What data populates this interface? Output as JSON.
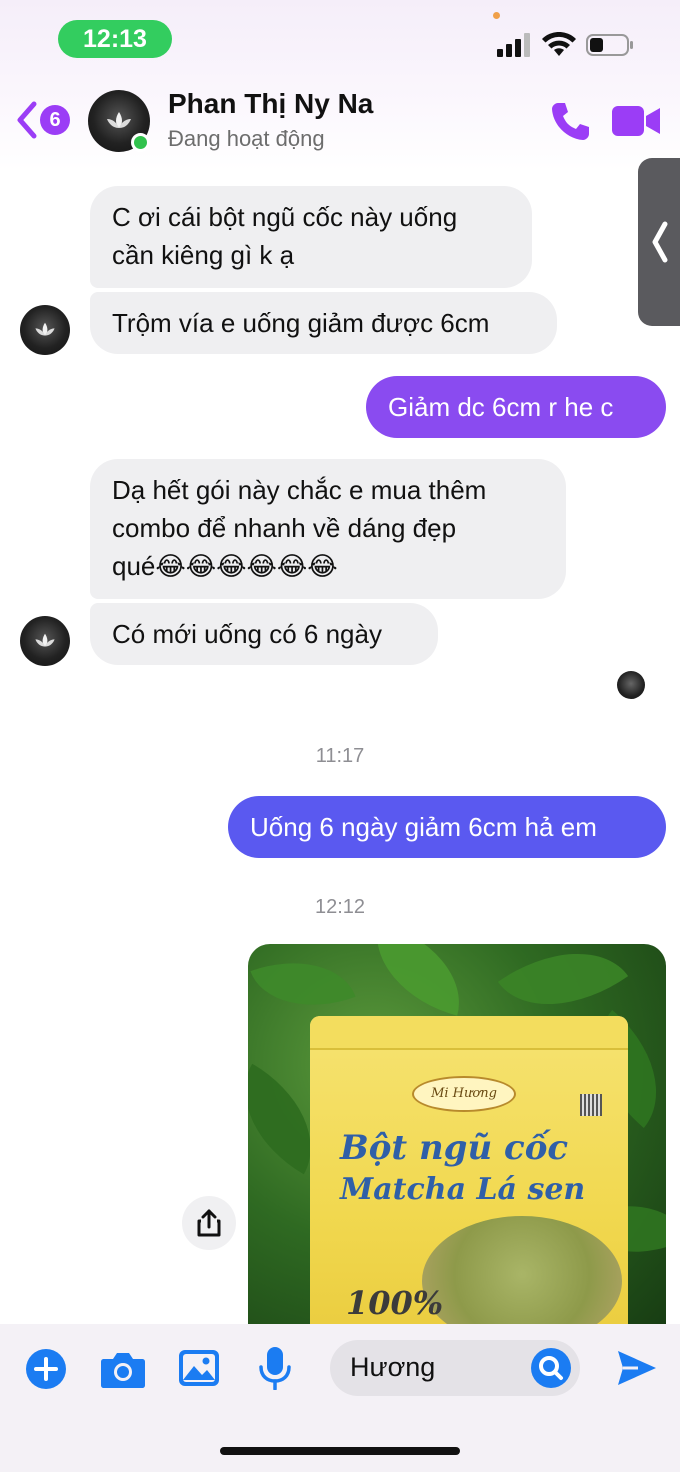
{
  "status_bar": {
    "time": "12:13"
  },
  "header": {
    "back_count": "6",
    "contact_name": "Phan Thị Ny Na",
    "contact_status": "Đang hoạt động"
  },
  "messages": [
    {
      "direction": "in",
      "text_lines": [
        "C ơi cái bột ngũ cốc này uống",
        "cần kiêng gì k ạ"
      ]
    },
    {
      "direction": "in",
      "text": "Trộm vía e uống giảm được 6cm"
    },
    {
      "direction": "out",
      "text": "Giảm dc 6cm r he c"
    },
    {
      "direction": "in",
      "text_lines": [
        "Dạ hết gói này chắc e mua thêm",
        "combo để nhanh về dáng đẹp",
        "qué😂😂😂😂😂😂"
      ]
    },
    {
      "direction": "in",
      "text": "Có mới uống có 6 ngày"
    },
    {
      "direction": "out",
      "text": "Uống 6 ngày giảm 6cm hả em"
    }
  ],
  "timestamps": [
    "11:17",
    "12:12"
  ],
  "photo": {
    "brand": "Mi Hương",
    "title_line1": "Bột ngũ cốc",
    "title_line2": "Matcha Lá sen",
    "percent": "100%"
  },
  "composer": {
    "input_value": "Hương"
  },
  "colors": {
    "accent_purple": "#9b3df6",
    "bubble_out_purple": "#8a4bf0",
    "bubble_out_blue": "#5a59f0",
    "bubble_in": "#efeff1",
    "icon_blue": "#1b7cf2",
    "online_green": "#31c24d"
  },
  "icons": [
    "back-chevron-icon",
    "phone-icon",
    "video-camera-icon",
    "plus-icon",
    "camera-icon",
    "gallery-icon",
    "microphone-icon",
    "search-icon",
    "send-icon",
    "share-icon"
  ]
}
